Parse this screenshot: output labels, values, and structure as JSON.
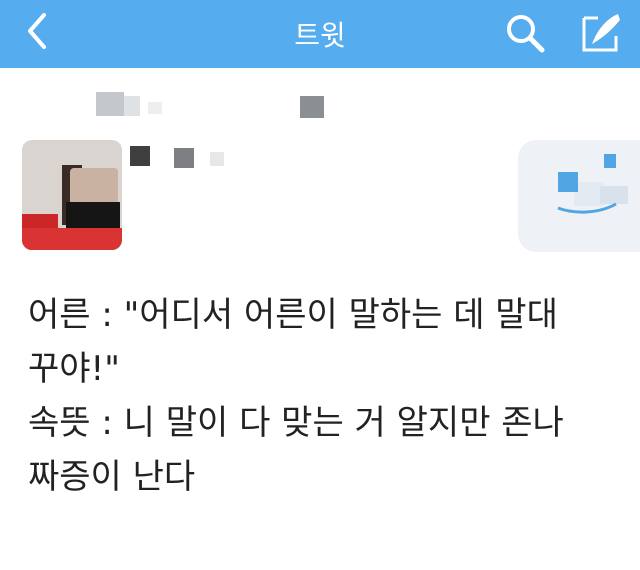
{
  "header": {
    "title": "트윗",
    "back_icon": "chevron-left-icon",
    "search_icon": "search-icon",
    "compose_icon": "compose-feather-icon",
    "background": "#55acee"
  },
  "tweet": {
    "lines": [
      "어른 : \"어디서 어른이 말하는 데 말대",
      "꾸야!\"",
      "속뜻 : 니 말이 다 맞는 거 알지만 존나",
      "짜증이 난다"
    ]
  }
}
